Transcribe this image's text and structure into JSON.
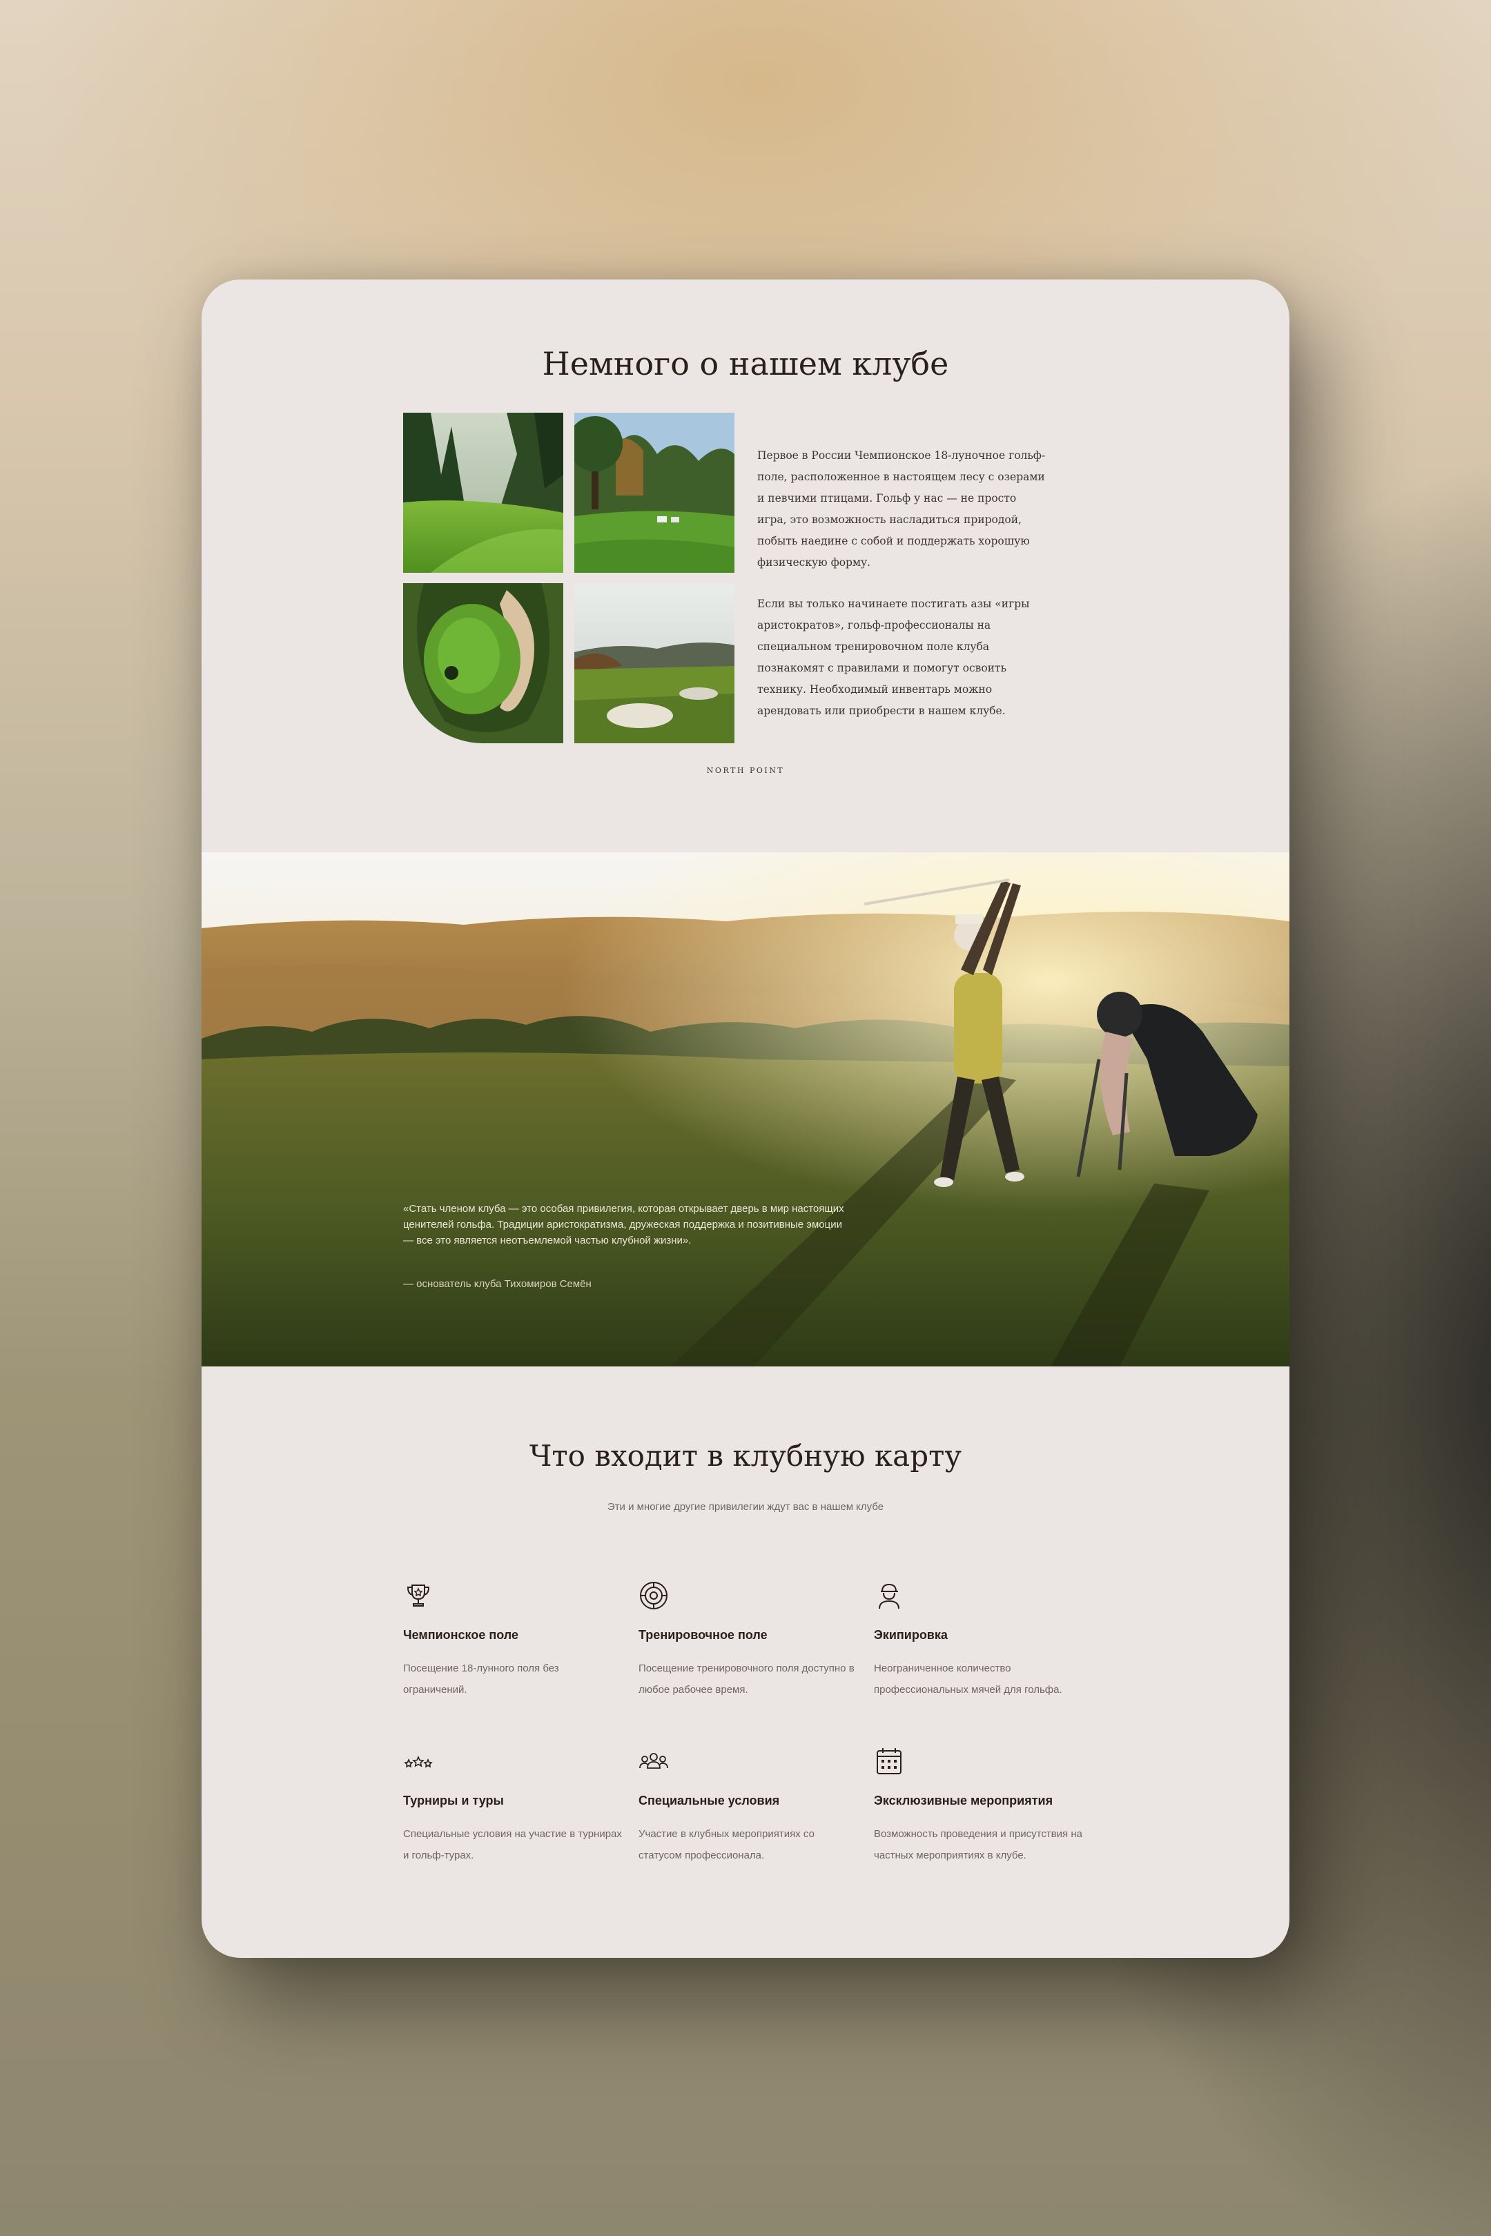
{
  "about": {
    "title": "Немного о нашем клубе",
    "paragraph1": "Первое в России Чемпионское 18-луночное гольф-поле, расположенное в настоящем лесу с озерами и певчими птицами. Гольф у нас — не просто игра, это возможность насладиться природой, побыть наедине с собой и поддержать хорошую физическую форму.",
    "paragraph2": "Если вы только начинаете постигать азы «игры аристократов», гольф-профессионалы на специальном тренировочном поле клуба познакомят с правилами и помогут освоить технику. Необходимый инвентарь можно арендовать или приобрести в нашем клубе.",
    "signature": "NORTH POINT",
    "photos": [
      "forest-fairway-photo",
      "golf-carts-course-photo",
      "aerial-green-photo",
      "sand-bunker-photo"
    ]
  },
  "hero": {
    "quote": "«Стать членом клуба — это особая привилегия, которая открывает дверь в мир настоящих ценителей гольфа. Традиции аристократизма, дружеская поддержка и позитивные эмоции — все это является неотъемлемой частью клубной жизни».",
    "author": "— основатель клуба Тихомиров Семён",
    "image": "golfer-at-sunset-photo"
  },
  "benefits": {
    "title": "Что входит в клубную карту",
    "subtitle": "Эти и многие другие привилегии ждут вас в нашем клубе",
    "items": [
      {
        "icon": "trophy-icon",
        "name": "Чемпионское поле",
        "desc": "Посещение 18-лунного поля без ограничений."
      },
      {
        "icon": "target-icon",
        "name": "Тренировочное поле",
        "desc": "Посещение тренировочного поля доступно в любое рабочее время."
      },
      {
        "icon": "golfer-cap-icon",
        "name": "Экипировка",
        "desc": "Неограниченное количество профессиональных мячей для гольфа."
      },
      {
        "icon": "stars-icon",
        "name": "Турниры и туры",
        "desc": "Специальные условия на участие в турнирах и гольф-турах."
      },
      {
        "icon": "group-icon",
        "name": "Специальные условия",
        "desc": "Участие в клубных мероприятиях со статусом профессионала."
      },
      {
        "icon": "calendar-icon",
        "name": "Эксклюзивные мероприятия",
        "desc": "Возможность проведения и присутствия на частных мероприятиях в клубе."
      }
    ]
  },
  "colors": {
    "card_background": "#ebe6e3",
    "heading": "#2a1f1a",
    "body_text": "#3d3430",
    "muted_text": "#6e6560"
  }
}
